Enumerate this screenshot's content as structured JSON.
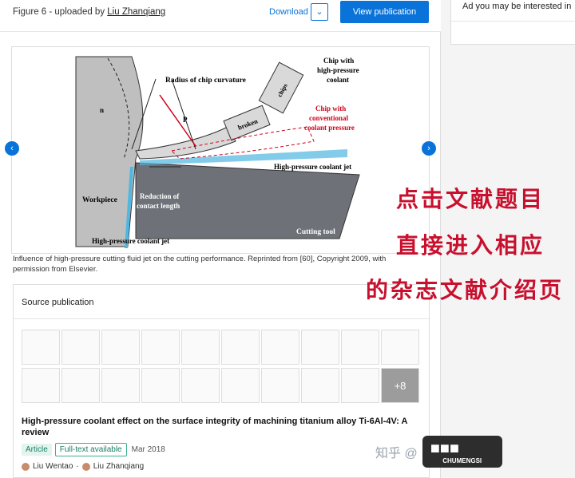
{
  "header": {
    "figure_label": "Figure 6 - uploaded by",
    "uploader": "Liu Zhanqiang",
    "download_label": "Download",
    "dropdown_icon": "chevron-down-icon",
    "view_button": "View publication"
  },
  "figure": {
    "labels": {
      "radius": "Radius of chip curvature",
      "chip_hp_1": "Chip with",
      "chip_hp_2": "high-pressure",
      "chip_hp_3": "coolant",
      "chips": "chips",
      "broken": "broken",
      "chip_conv_1": "Chip with",
      "chip_conv_2": "conventional",
      "chip_conv_3": "coolant pressure",
      "p": "P",
      "n": "n",
      "hp_jet_right": "High-pressure coolant jet",
      "reduction_1": "Reduction of",
      "reduction_2": "contact length",
      "workpiece": "Workpiece",
      "cutting_tool": "Cutting tool",
      "hp_jet_bottom": "High-pressure coolant jet"
    }
  },
  "caption": "Influence of high-pressure cutting fluid jet on the cutting performance. Reprinted from [60], Copyright 2009, with permission from Elsevier.",
  "source": {
    "heading": "Source publication",
    "more_thumbs": "+8",
    "title": "High-pressure coolant effect on the surface integrity of machining titanium alloy Ti-6Al-4V: A review",
    "badge_article": "Article",
    "badge_fulltext": "Full-text available",
    "date": "Mar 2018",
    "author1": "Liu Wentao",
    "author2": "Liu Zhanqiang"
  },
  "sidebar": {
    "ad_text": "Ad you may be interested in"
  },
  "overlay": {
    "line1": "点击文献题目",
    "line2": "直接进入相应",
    "line3": "的杂志文献介绍页"
  },
  "watermark": {
    "zhihu": "知乎 @",
    "logo_text": "CHUMENGSI"
  },
  "colors": {
    "accent": "#0a73d9",
    "overlay_red": "#c8102e",
    "badge_green": "#1a7e63"
  }
}
